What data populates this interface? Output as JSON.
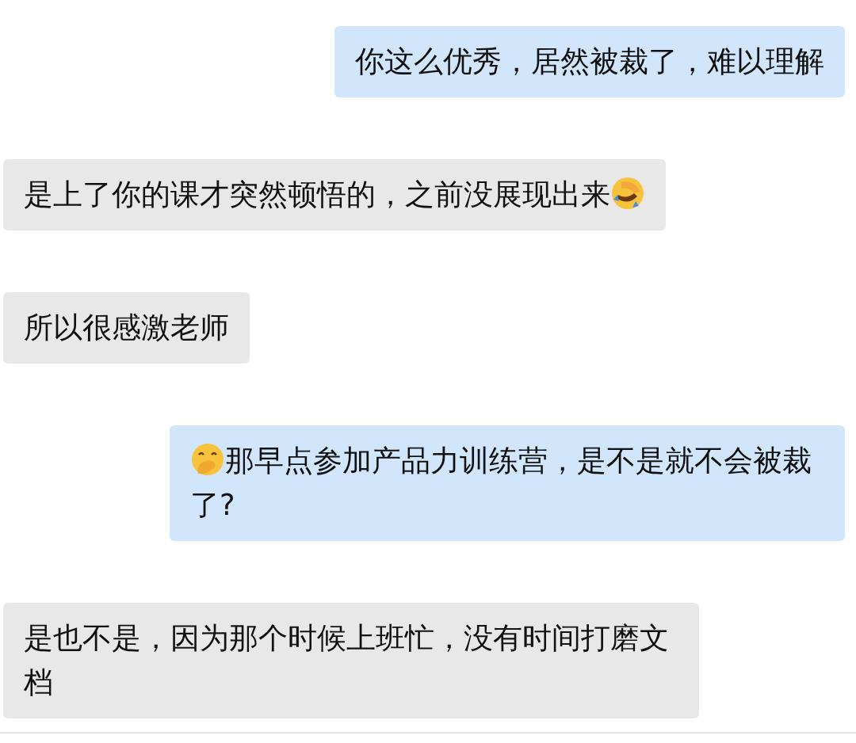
{
  "messages": [
    {
      "kind": "sent",
      "parts": [
        {
          "kind": "text",
          "text": "你这么优秀，居然被裁了，难以理解"
        }
      ]
    },
    {
      "kind": "received",
      "parts": [
        {
          "kind": "text",
          "text": "是上了你的课才突然顿悟的，之前没展现出来"
        },
        {
          "kind": "emoji"
        }
      ]
    },
    {
      "kind": "received",
      "parts": [
        {
          "kind": "text",
          "text": "所以很感激老师"
        }
      ]
    },
    {
      "kind": "sent",
      "parts": [
        {
          "kind": "emoji"
        },
        {
          "kind": "text",
          "text": "那早点参加产品力训练营，是不是就不会被裁了?"
        }
      ]
    },
    {
      "kind": "received",
      "parts": [
        {
          "kind": "text",
          "text": "是也不是，因为那个时候上班忙，没有时间打磨文档"
        }
      ]
    }
  ]
}
